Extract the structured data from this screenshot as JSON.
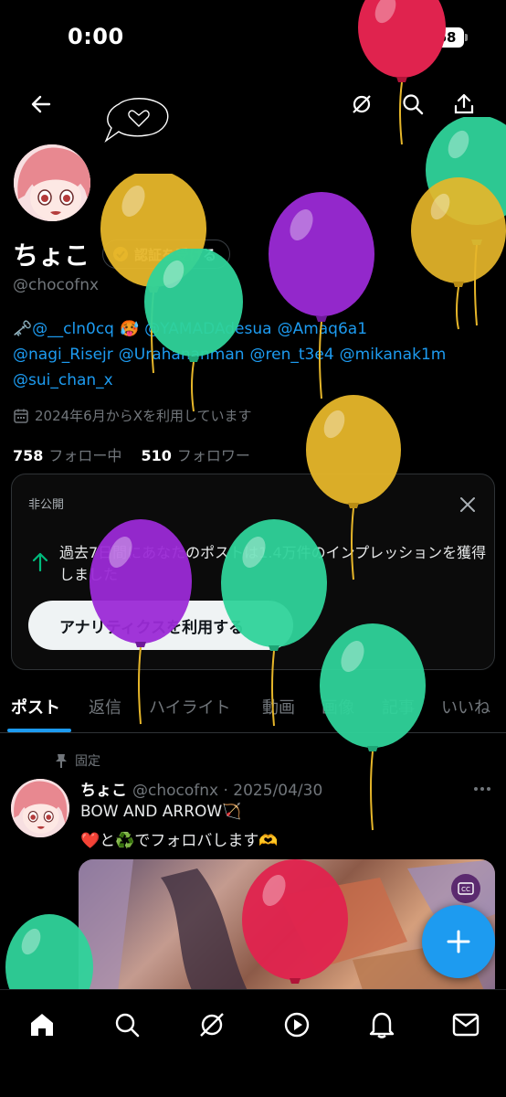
{
  "status_bar": {
    "time": "0:00",
    "battery": "68"
  },
  "profile": {
    "display_name": "ちょこ",
    "verify_label": "認証を受ける",
    "handle": "@chocofnx",
    "bio_key_icon": "🗝️",
    "bio_mentions": [
      "@__cln0cq",
      "🥵",
      "@YAMADAdesua",
      "@Amaq6a1",
      "@nagi_Risejr",
      "@Urahananman",
      "@ren_t3e4",
      "@mikanak1m",
      "@sui_chan_x"
    ],
    "joined": "2024年6月からXを利用しています",
    "following_count": "758",
    "following_label": "フォロー中",
    "followers_count": "510",
    "followers_label": "フォロワー"
  },
  "analytics_card": {
    "label": "非公開",
    "text": "過去7日間にあなたのポストは1.4万件のインプレッションを獲得しました",
    "button": "アナリティクスを利用する"
  },
  "tabs": [
    "ポスト",
    "返信",
    "ハイライト",
    "動画",
    "画像",
    "記事",
    "いいね"
  ],
  "post": {
    "pinned_label": "固定",
    "name": "ちょこ",
    "meta": "@chocofnx · 2025/04/30",
    "line1": "BOW AND ARROW🏹",
    "line2": "❤️と♻️でフォロバします🫶"
  },
  "colors": {
    "accent": "#1d9bf0",
    "balloon_yellow": "#e6b62a",
    "balloon_green": "#2fd39a",
    "balloon_purple": "#9b2ad6",
    "balloon_red": "#e0234e"
  },
  "icons": {
    "header": [
      "back-arrow-icon",
      "heart-speech-icon",
      "grok-icon",
      "search-icon",
      "share-icon"
    ],
    "nav": [
      "home-icon",
      "search-icon",
      "grok-icon",
      "video-icon",
      "bell-icon",
      "mail-icon"
    ]
  }
}
